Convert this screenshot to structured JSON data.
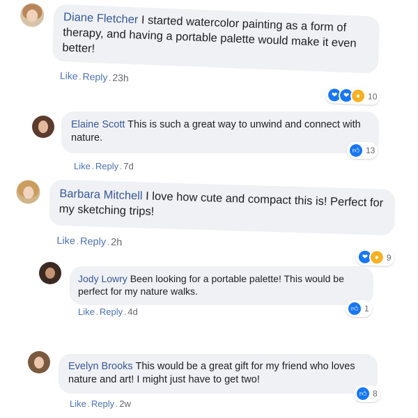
{
  "comments": [
    {
      "author": "Diane Fletcher",
      "text": "I started watercolor painting as a form of therapy, and having a portable palette would make it even better!",
      "like_label": "Like",
      "reply_label": "Reply",
      "time": "23h",
      "reactions": [
        "care",
        "care",
        "wow"
      ],
      "reaction_count": "10"
    },
    {
      "author": "Elaine Scott",
      "text": "This is such a great way to unwind and connect with nature.",
      "like_label": "Like",
      "reply_label": "Reply",
      "time": "7d",
      "reactions": [
        "like"
      ],
      "reaction_count": "13"
    },
    {
      "author": "Barbara Mitchell",
      "text": "I love how cute and compact this is! Perfect for my sketching trips!",
      "like_label": "Like",
      "reply_label": "Reply",
      "time": "2h",
      "reactions": [
        "care",
        "wow"
      ],
      "reaction_count": "9"
    },
    {
      "author": "Jody Lowry",
      "text": "Been looking for a portable palette! This would be perfect for my nature walks.",
      "like_label": "Like",
      "reply_label": "Reply",
      "time": "4d",
      "reactions": [
        "like"
      ],
      "reaction_count": "1"
    },
    {
      "author": "Evelyn Brooks",
      "text": "This would be a great gift for my friend who loves nature and art! I might just have to get two!",
      "like_label": "Like",
      "reply_label": "Reply",
      "time": "2w",
      "reactions": [
        "like"
      ],
      "reaction_count": "8"
    }
  ],
  "colors": {
    "author": "#385898",
    "action": "#4b72b2",
    "bubble": "#eff1f4",
    "like_blue": "#1877f2",
    "wow_yellow": "#f7b125"
  }
}
